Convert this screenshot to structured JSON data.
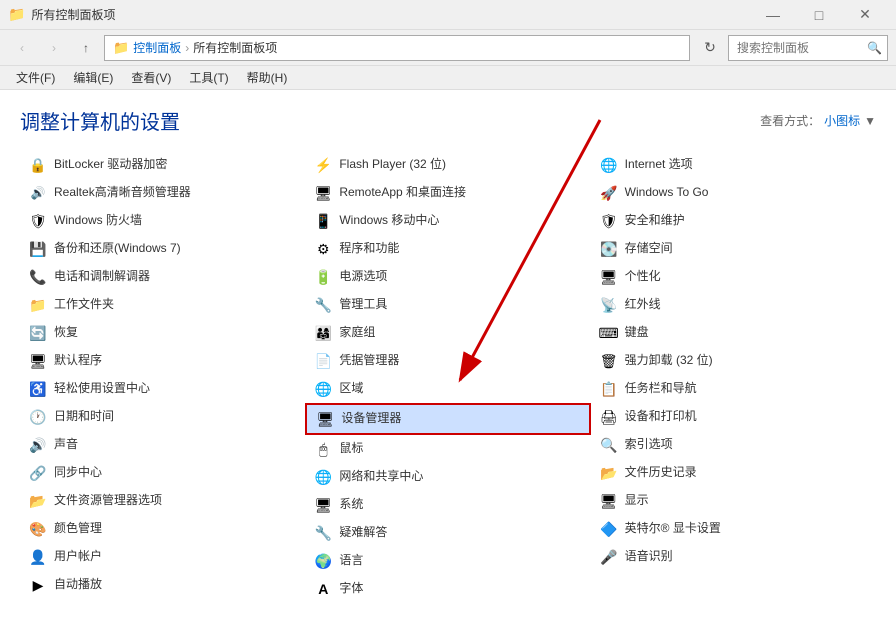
{
  "titleBar": {
    "title": "所有控制面板项",
    "iconLabel": "folder-icon",
    "controls": {
      "minimize": "—",
      "maximize": "□",
      "close": "✕"
    }
  },
  "navBar": {
    "back": "‹",
    "forward": "›",
    "up": "↑",
    "addressParts": [
      "控制面板",
      "所有控制面板项"
    ],
    "addressIcon": "📁",
    "searchPlaceholder": "搜索控制面板"
  },
  "menuBar": {
    "items": [
      "文件(F)",
      "编辑(E)",
      "查看(V)",
      "工具(T)",
      "帮助(H)"
    ]
  },
  "pageHeader": {
    "title": "调整计算机的设置",
    "viewLabel": "查看方式：",
    "viewOption": "小图标",
    "viewDropdown": "▼"
  },
  "gridItems": [
    {
      "icon": "🔒",
      "label": "BitLocker 驱动器加密"
    },
    {
      "icon": "🎵",
      "label": "Realtek高清晰音频管理器"
    },
    {
      "icon": "🔥",
      "label": "Windows 防火墙"
    },
    {
      "icon": "💾",
      "label": "备份和还原(Windows 7)"
    },
    {
      "icon": "📞",
      "label": "电话和调制解调器"
    },
    {
      "icon": "📁",
      "label": "工作文件夹"
    },
    {
      "icon": "🔄",
      "label": "恢复"
    },
    {
      "icon": "🖥",
      "label": "默认程序"
    },
    {
      "icon": "♿",
      "label": "轻松使用设置中心"
    },
    {
      "icon": "🕐",
      "label": "日期和时间"
    },
    {
      "icon": "🔊",
      "label": "声音"
    },
    {
      "icon": "🔗",
      "label": "同步中心"
    },
    {
      "icon": "📂",
      "label": "文件资源管理器选项"
    },
    {
      "icon": "🎨",
      "label": "颜色管理"
    },
    {
      "icon": "👤",
      "label": "用户帐户"
    },
    {
      "icon": "▶",
      "label": "自动播放"
    },
    {
      "icon": "⚡",
      "label": "Flash Player (32 位)",
      "highlight": false
    },
    {
      "icon": "🖥",
      "label": "RemoteApp 和桌面连接"
    },
    {
      "icon": "📱",
      "label": "Windows 移动中心"
    },
    {
      "icon": "⚙",
      "label": "程序和功能"
    },
    {
      "icon": "🔋",
      "label": "电源选项"
    },
    {
      "icon": "🔧",
      "label": "管理工具"
    },
    {
      "icon": "👨‍👩‍👧",
      "label": "家庭组"
    },
    {
      "icon": "📄",
      "label": "凭据管理器"
    },
    {
      "icon": "🌐",
      "label": "区域"
    },
    {
      "icon": "🖥",
      "label": "设备管理器",
      "selected": true
    },
    {
      "icon": "🖱",
      "label": "鼠标"
    },
    {
      "icon": "🌐",
      "label": "网络和共享中心"
    },
    {
      "icon": "🖥",
      "label": "系统"
    },
    {
      "icon": "🔧",
      "label": "疑难解答"
    },
    {
      "icon": "🌍",
      "label": "语言"
    },
    {
      "icon": "A",
      "label": "字体"
    },
    {
      "icon": "🌐",
      "label": "Internet 选项"
    },
    {
      "icon": "🚀",
      "label": "Windows To Go"
    },
    {
      "icon": "🛡",
      "label": "安全和维护"
    },
    {
      "icon": "💽",
      "label": "存储空间"
    },
    {
      "icon": "🖥",
      "label": "个性化"
    },
    {
      "icon": "📡",
      "label": "红外线"
    },
    {
      "icon": "⌨",
      "label": "键盘"
    },
    {
      "icon": "🗑",
      "label": "强力卸载 (32 位)"
    },
    {
      "icon": "📋",
      "label": "任务栏和导航"
    },
    {
      "icon": "🖨",
      "label": "设备和打印机"
    },
    {
      "icon": "🔍",
      "label": "索引选项"
    },
    {
      "icon": "📂",
      "label": "文件历史记录"
    },
    {
      "icon": "🖥",
      "label": "显示"
    },
    {
      "icon": "🔷",
      "label": "英特尔® 显卡设置"
    },
    {
      "icon": "🎤",
      "label": "语音识别"
    }
  ]
}
